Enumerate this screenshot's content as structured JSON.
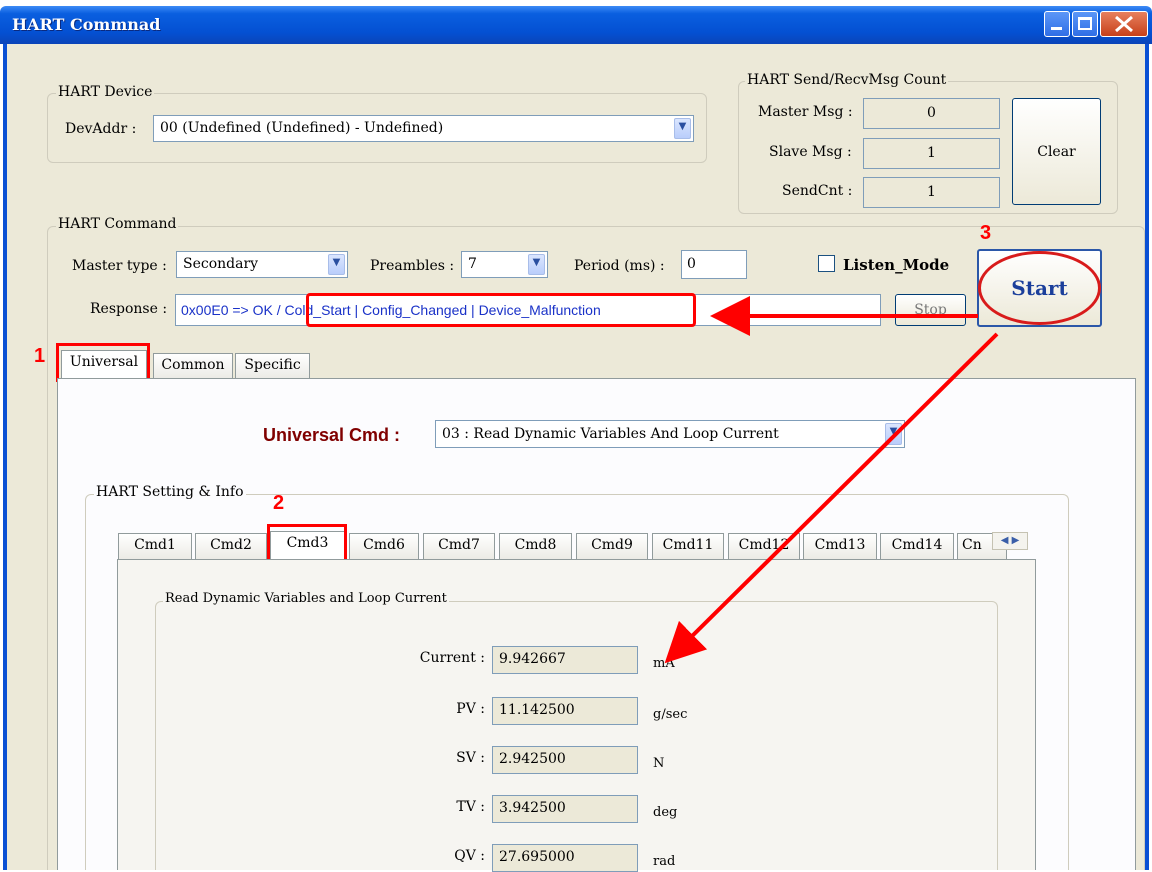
{
  "window": {
    "title": "HART Commnad"
  },
  "hart_device": {
    "group_label": "HART Device",
    "devaddr_label": "DevAddr :",
    "devaddr_value": "00  (Undefined (Undefined) - Undefined)"
  },
  "msg_count": {
    "group_label": "HART Send/RecvMsg Count",
    "master_label": "Master Msg :",
    "master_value": "0",
    "slave_label": "Slave Msg :",
    "slave_value": "1",
    "sendcnt_label": "SendCnt :",
    "sendcnt_value": "1",
    "clear_label": "Clear"
  },
  "hart_command": {
    "group_label": "HART Command",
    "master_type_label": "Master type :",
    "master_type_value": "Secondary",
    "preambles_label": "Preambles :",
    "preambles_value": "7",
    "period_label": "Period (ms) :",
    "period_value": "0",
    "listen_mode_label": "Listen_Mode",
    "start_label": "Start",
    "response_label": "Response :",
    "response_value": "0x00E0 => OK / Cold_Start | Config_Changed | Device_Malfunction",
    "stop_label": "Stop"
  },
  "main_tabs": [
    "Universal",
    "Common",
    "Specific"
  ],
  "universal": {
    "cmd_label": "Universal Cmd :",
    "cmd_value": "03 : Read Dynamic Variables And Loop Current",
    "setting_group_label": "HART Setting & Info",
    "cmd_tabs": [
      "Cmd1",
      "Cmd2",
      "Cmd3",
      "Cmd6",
      "Cmd7",
      "Cmd8",
      "Cmd9",
      "Cmd11",
      "Cmd12",
      "Cmd13",
      "Cmd14",
      "Cn"
    ]
  },
  "dynamic_vars": {
    "group_label": "Read Dynamic Variables and Loop Current",
    "rows": [
      {
        "label": "Current :",
        "value": "9.942667",
        "unit": "mA"
      },
      {
        "label": "PV :",
        "value": "11.142500",
        "unit": "g/sec"
      },
      {
        "label": "SV :",
        "value": "2.942500",
        "unit": "N"
      },
      {
        "label": "TV :",
        "value": "3.942500",
        "unit": "deg"
      },
      {
        "label": "QV :",
        "value": "27.695000",
        "unit": "rad"
      }
    ]
  },
  "annotations": {
    "step1": "1",
    "step2": "2",
    "step3": "3"
  },
  "colors": {
    "annotation": "#ff0000",
    "response_text": "#1a32c8",
    "universal_label": "#800000",
    "titlebar": "#0a50d4"
  }
}
